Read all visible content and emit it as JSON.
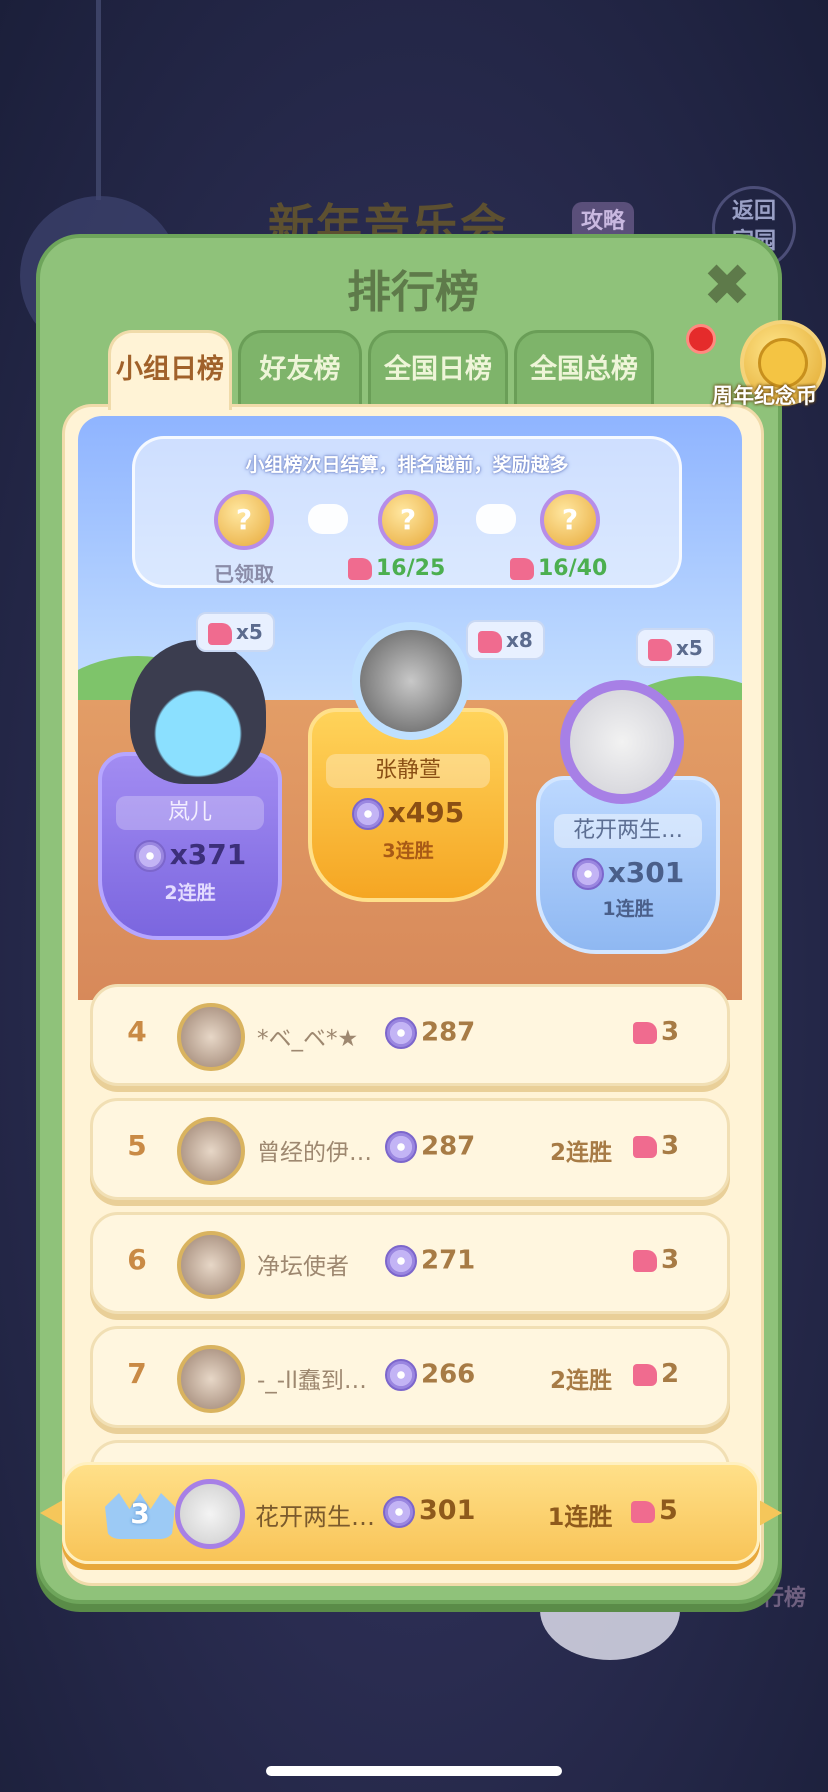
{
  "background": {
    "event_title": "新年音乐会",
    "strategy_label": "攻略",
    "return_label": "返回\n家园",
    "side_label": "排行榜"
  },
  "panel": {
    "title": "排行榜",
    "tabs": [
      {
        "label": "小组日榜",
        "active": true
      },
      {
        "label": "好友榜",
        "active": false
      },
      {
        "label": "全国日榜",
        "active": false
      },
      {
        "label": "全国总榜",
        "active": false
      }
    ],
    "coin_label": "周年纪念币"
  },
  "rules": {
    "text": "小组榜次日结算，排名越前，奖励越多",
    "icon_glyph": "?",
    "rewards": [
      {
        "label": "已领取"
      },
      {
        "progress": "16/25"
      },
      {
        "progress": "16/40"
      }
    ]
  },
  "podium": [
    {
      "place": 2,
      "name": "岚儿",
      "score": "x371",
      "streak": "2连胜",
      "reward": "x5"
    },
    {
      "place": 1,
      "name": "张静萱",
      "score": "x495",
      "streak": "3连胜",
      "reward": "x8"
    },
    {
      "place": 3,
      "name": "花开两生…",
      "score": "x301",
      "streak": "1连胜",
      "reward": "x5"
    }
  ],
  "list": [
    {
      "rank": "4",
      "name": "*ベ_ベ*★",
      "score": "287",
      "streak": "",
      "reward": "3"
    },
    {
      "rank": "5",
      "name": "曾经的伊…",
      "score": "287",
      "streak": "2连胜",
      "reward": "3"
    },
    {
      "rank": "6",
      "name": "净坛使者",
      "score": "271",
      "streak": "",
      "reward": "3"
    },
    {
      "rank": "7",
      "name": "-_-ll蠢到…",
      "score": "266",
      "streak": "2连胜",
      "reward": "2"
    }
  ],
  "me": {
    "rank": "3",
    "name": "花开两生…",
    "score": "301",
    "streak": "1连胜",
    "reward": "5"
  },
  "colors": {
    "panel": "#8fc27a",
    "accent_gold": "#f5a623",
    "inner": "#fff3d6"
  }
}
